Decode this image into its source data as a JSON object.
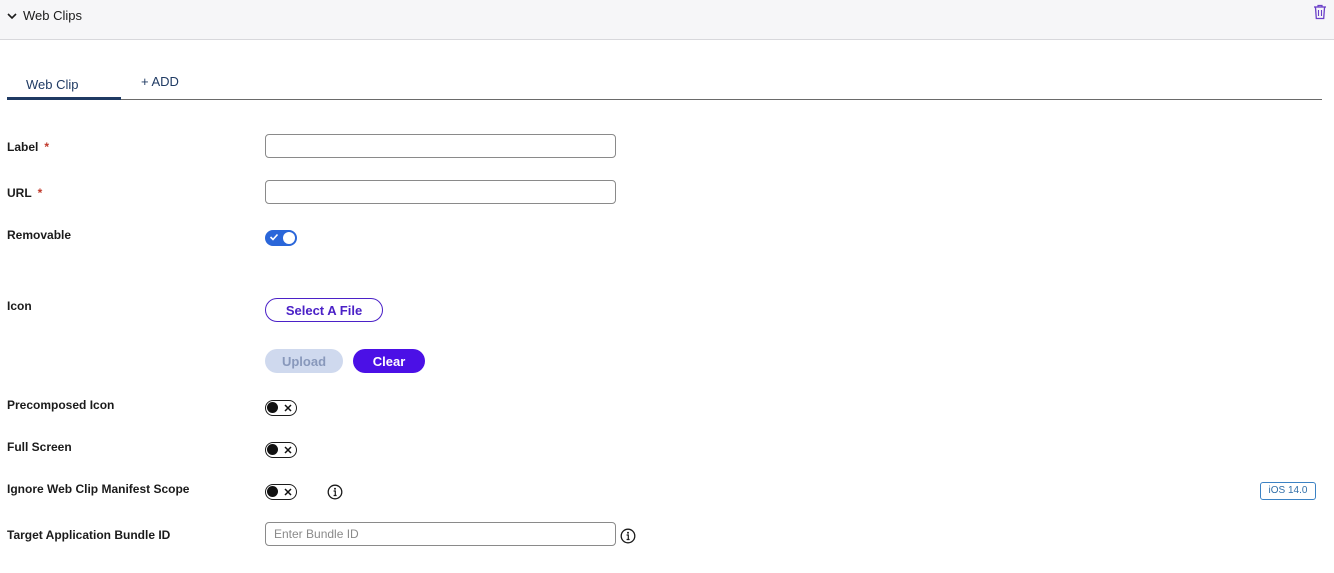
{
  "section": {
    "title": "Web Clips",
    "collapse_icon": "chevron-down-icon",
    "delete_icon": "trash-icon"
  },
  "tabs": [
    {
      "label": "Web Clip",
      "active": true
    },
    {
      "label": "+ ADD",
      "active": false
    }
  ],
  "form": {
    "label": {
      "label": "Label",
      "required_mark": "*",
      "value": ""
    },
    "url": {
      "label": "URL",
      "required_mark": "*",
      "value": ""
    },
    "removable": {
      "label": "Removable",
      "state": "on"
    },
    "icon": {
      "label": "Icon",
      "select_button": "Select A File",
      "upload_button": "Upload",
      "clear_button": "Clear"
    },
    "precomposed_icon": {
      "label": "Precomposed Icon",
      "state": "off"
    },
    "full_screen": {
      "label": "Full Screen",
      "state": "off"
    },
    "ignore_manifest_scope": {
      "label": "Ignore Web Clip Manifest Scope",
      "state": "off",
      "info_icon": "info-icon",
      "badge": "iOS 14.0"
    },
    "target_bundle_id": {
      "label": "Target Application Bundle ID",
      "placeholder": "Enter Bundle ID",
      "value": "",
      "info_icon": "info-icon"
    }
  },
  "colors": {
    "accent": "#4b10e6",
    "toggle_on": "#2a66d9",
    "tab_active": "#1f3a63",
    "required": "#c0392b",
    "badge": "#3b82c4"
  }
}
